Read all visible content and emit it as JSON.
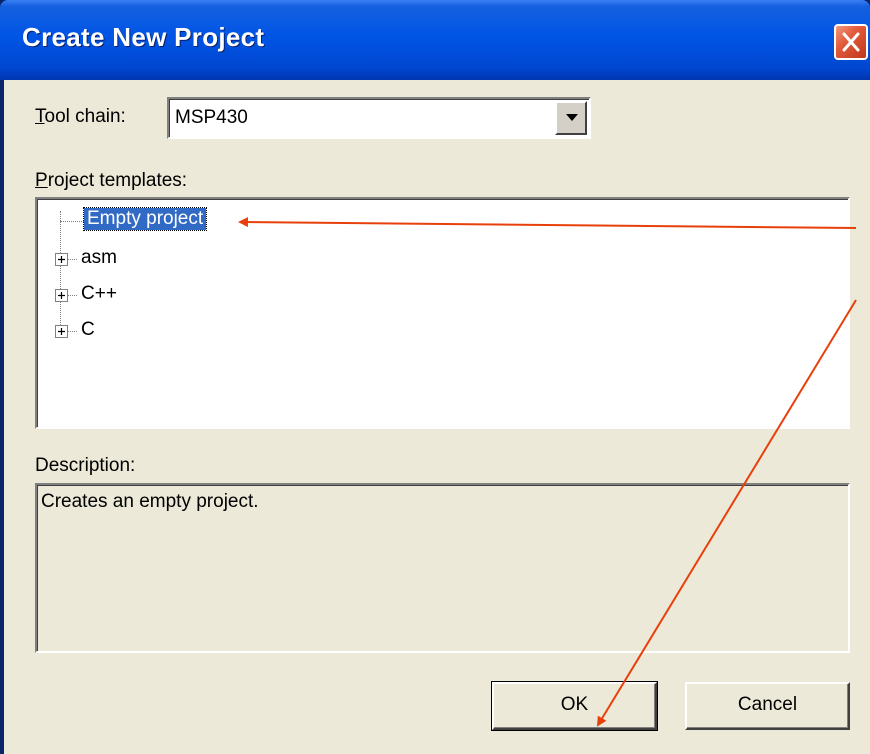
{
  "window": {
    "title": "Create New Project"
  },
  "toolchain": {
    "label_access": "T",
    "label_rest": "ool chain:",
    "value": "MSP430"
  },
  "templates": {
    "label_access": "P",
    "label_rest": "roject templates:",
    "items": [
      {
        "label": "Empty project",
        "selected": true,
        "expandable": false
      },
      {
        "label": "asm",
        "selected": false,
        "expandable": true
      },
      {
        "label": "C++",
        "selected": false,
        "expandable": true
      },
      {
        "label": "C",
        "selected": false,
        "expandable": true
      }
    ]
  },
  "description": {
    "label": "Description:",
    "text": "Creates an empty project."
  },
  "buttons": {
    "ok": "OK",
    "cancel": "Cancel"
  },
  "colors": {
    "selection": "#316ac5",
    "annotation_arrow": "#e8400c",
    "titlebar": "#0055e5"
  }
}
